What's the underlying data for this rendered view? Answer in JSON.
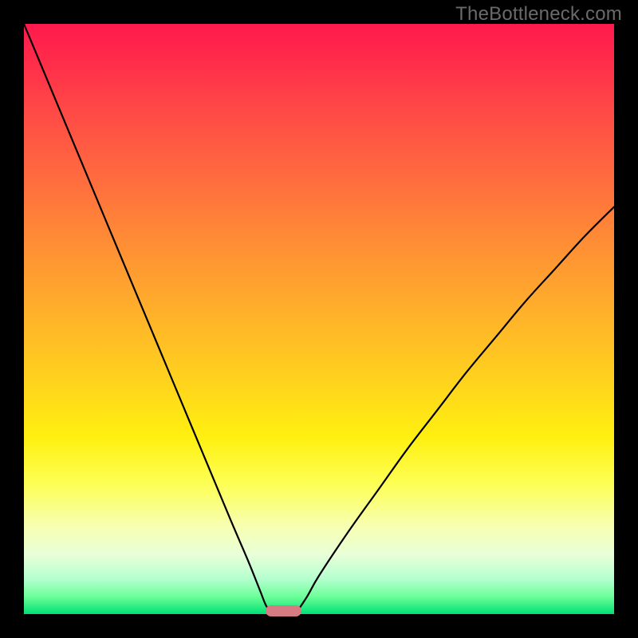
{
  "watermark": "TheBottleneck.com",
  "chart_data": {
    "type": "line",
    "title": "",
    "xlabel": "",
    "ylabel": "",
    "xlim": [
      0,
      100
    ],
    "ylim": [
      0,
      100
    ],
    "grid": false,
    "legend": false,
    "background_gradient": {
      "top": "#ff1a4d",
      "mid": "#ffd11e",
      "bottom": "#00e074",
      "meaning_top": "bad",
      "meaning_bottom": "good"
    },
    "series": [
      {
        "name": "left-branch",
        "x": [
          0,
          5,
          10,
          15,
          20,
          25,
          30,
          35,
          38,
          40,
          41,
          42
        ],
        "values": [
          100,
          88,
          76,
          64,
          52,
          40,
          28,
          16,
          9,
          4,
          1.5,
          0
        ]
      },
      {
        "name": "right-branch",
        "x": [
          46,
          48,
          50,
          55,
          60,
          65,
          70,
          75,
          80,
          85,
          90,
          95,
          100
        ],
        "values": [
          0,
          3,
          6.5,
          14,
          21,
          28,
          34.5,
          41,
          47,
          53,
          58.5,
          64,
          69
        ]
      }
    ],
    "marker": {
      "name": "bottleneck-pill",
      "x_center": 44,
      "y": 0,
      "width_pct": 6,
      "color": "#d67b83"
    }
  },
  "colors": {
    "frame": "#000000",
    "curve": "#000000",
    "watermark": "#6a6a6a"
  }
}
